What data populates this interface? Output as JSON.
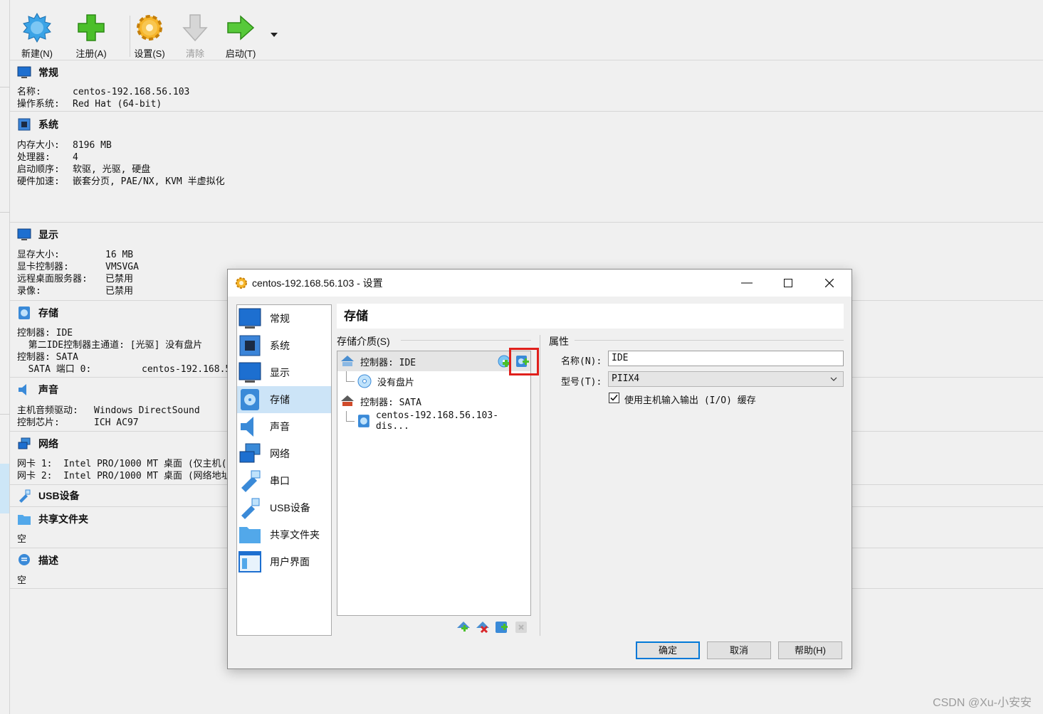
{
  "toolbar": {
    "new": "新建(N)",
    "register": "注册(A)",
    "settings": "设置(S)",
    "discard": "清除",
    "start": "启动(T)"
  },
  "details": {
    "general": {
      "title": "常规",
      "name_k": "名称:",
      "name_v": "centos-192.168.56.103",
      "os_k": "操作系统:",
      "os_v": "Red Hat (64-bit)"
    },
    "system": {
      "title": "系统",
      "mem_k": "内存大小:",
      "mem_v": "8196 MB",
      "cpu_k": "处理器:",
      "cpu_v": "4",
      "boot_k": "启动顺序:",
      "boot_v": "软驱, 光驱, 硬盘",
      "accel_k": "硬件加速:",
      "accel_v": "嵌套分页, PAE/NX, KVM 半虚拟化"
    },
    "display": {
      "title": "显示",
      "vram_k": "显存大小:",
      "vram_v": "16 MB",
      "gc_k": "显卡控制器:",
      "gc_v": "VMSVGA",
      "rdp_k": "远程桌面服务器:",
      "rdp_v": "已禁用",
      "rec_k": "录像:",
      "rec_v": "已禁用"
    },
    "storage": {
      "title": "存储",
      "l1": "控制器: IDE",
      "l2": "  第二IDE控制器主通道: [光驱] 没有盘片",
      "l3": "控制器: SATA",
      "l4_k": "  SATA 端口 0:",
      "l4_v": "centos-192.168.5"
    },
    "audio": {
      "title": "声音",
      "drv_k": "主机音频驱动:",
      "drv_v": "Windows DirectSound",
      "chip_k": "控制芯片:",
      "chip_v": "ICH AC97"
    },
    "network": {
      "title": "网络",
      "n1": "网卡 1:  Intel PRO/1000 MT 桌面 (仅主机(",
      "n2": "网卡 2:  Intel PRO/1000 MT 桌面 (网络地址"
    },
    "usb": {
      "title": "USB设备"
    },
    "shared": {
      "title": "共享文件夹",
      "v": "空"
    },
    "desc": {
      "title": "描述",
      "v": "空"
    }
  },
  "dialog": {
    "title": "centos-192.168.56.103 - 设置",
    "nav": [
      "常规",
      "系统",
      "显示",
      "存储",
      "声音",
      "网络",
      "串口",
      "USB设备",
      "共享文件夹",
      "用户界面"
    ],
    "page_title": "存储",
    "storage_media_label": "存储介质(S)",
    "attributes_label": "属性",
    "tree": {
      "ide": "控制器: IDE",
      "ide_child": "没有盘片",
      "sata": "控制器: SATA",
      "sata_child": "centos-192.168.56.103-dis..."
    },
    "name_label": "名称(N):",
    "name_value": "IDE",
    "type_label": "型号(T):",
    "type_value": "PIIX4",
    "cache_label": "使用主机输入输出 (I/O) 缓存",
    "ok": "确定",
    "cancel": "取消",
    "help": "帮助(H)"
  },
  "watermark": "CSDN @Xu-小安安",
  "colors": {
    "accent": "#0078d7",
    "highlight_box": "#e0201c",
    "selection": "#cce4f7"
  }
}
